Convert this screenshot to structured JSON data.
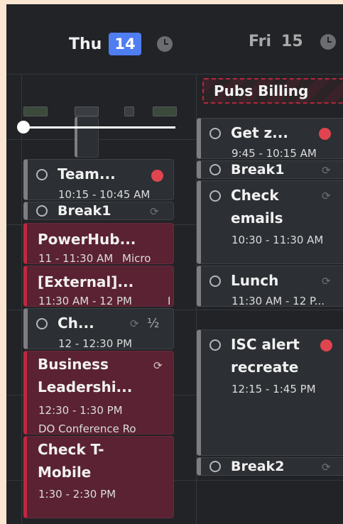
{
  "header": {
    "day1": {
      "name": "Thu",
      "date": "14"
    },
    "day2": {
      "name": "Fri",
      "date": "15"
    }
  },
  "allday": {
    "title": "Pubs Billing"
  },
  "icons": {
    "sync": "⟳",
    "half": "½"
  },
  "thu_events": [
    {
      "title": "Team...",
      "time": "10:15 - 10:45 AM",
      "status": "red-dot"
    },
    {
      "title": "Break1",
      "status": "sync"
    },
    {
      "title": "PowerHub...",
      "time": "11 - 11:30 AM",
      "location": "Micro"
    },
    {
      "title": "[External]...",
      "time": "11:30 AM - 12 PM",
      "location": "I"
    },
    {
      "title": "Ch...",
      "time": "12 - 12:30 PM",
      "status": "sync-half"
    },
    {
      "title_line1": "Business",
      "title_line2": "Leadershi...",
      "time": "12:30 - 1:30 PM",
      "location": "DO Conference Ro"
    },
    {
      "title_line1": "Check T-",
      "title_line2": "Mobile",
      "time": "1:30 - 2:30 PM"
    }
  ],
  "fri_events": [
    {
      "title": "Get z...",
      "time": "9:45 - 10:15 AM",
      "status": "red-dot"
    },
    {
      "title": "Break1",
      "status": "sync"
    },
    {
      "title_line1": "Check",
      "title_line2": "emails",
      "time": "10:30 - 11:30 AM",
      "status": "sync"
    },
    {
      "title": "Lunch",
      "time": "11:30 AM - 12 P...",
      "status": "sync"
    },
    {
      "title_line1": "ISC alert",
      "title_line2": "recreate",
      "time": "12:15 - 1:45 PM",
      "status": "red-dot"
    },
    {
      "title": "Break2",
      "status": "sync"
    }
  ]
}
